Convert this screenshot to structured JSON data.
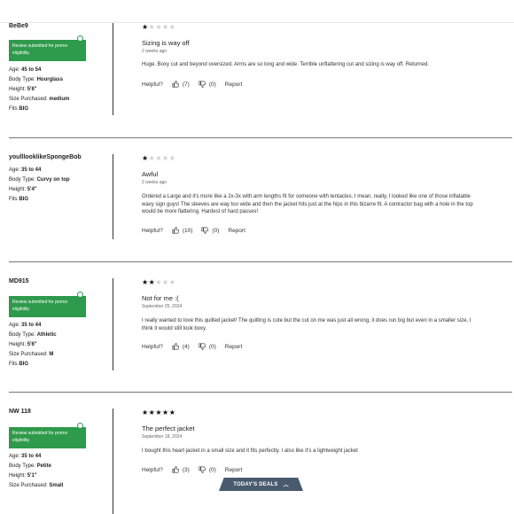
{
  "reviews": [
    {
      "user": "BeBe9",
      "badge": "Review submitted for promo eligibility.",
      "attributes": [
        {
          "label": "Age:",
          "value": "45 to 54"
        },
        {
          "label": "Body Type:",
          "value": "Hourglass"
        },
        {
          "label": "Height:",
          "value": "5'6\""
        },
        {
          "label": "Size Purchased:",
          "value": "medium"
        },
        {
          "label": "Fits",
          "value": "BIG"
        }
      ],
      "rating": 1,
      "title": "Sizing is way off",
      "date": "2 weeks ago",
      "body": "Huge. Boxy cut and beyond oversized. Arms are so long and wide. Terrible unflattering cut and sizing is way off. Returned.",
      "helpful_label": "Helpful?",
      "up": "(7)",
      "down": "(0)",
      "report": "Report"
    },
    {
      "user": "youlllooklikeSpongeBob",
      "attributes": [
        {
          "label": "Age:",
          "value": "35 to 44"
        },
        {
          "label": "Body Type:",
          "value": "Curvy on top"
        },
        {
          "label": "Height:",
          "value": "5'4\""
        },
        {
          "label": "Fits",
          "value": "BIG"
        }
      ],
      "rating": 1,
      "title": "Awful",
      "date": "2 weeks ago",
      "body": "Ordered a Large and it's more like a 2x-3x with arm lengths fit for someone with tentacles. I mean, really, I looked like one of those inflatable wavy sign guys! The sleeves are way too wide and then the jacket hits just at the hips in this bizarre fit. A contractor bag with a hole in the top would be more flattering. Hardest of hard passes!",
      "helpful_label": "Helpful?",
      "up": "(10)",
      "down": "(0)",
      "report": "Report"
    },
    {
      "user": "MD915",
      "badge": "Review submitted for promo eligibility.",
      "attributes": [
        {
          "label": "Age:",
          "value": "35 to 44"
        },
        {
          "label": "Body Type:",
          "value": "Athletic"
        },
        {
          "label": "Height:",
          "value": "5'6\""
        },
        {
          "label": "Size Purchased:",
          "value": "M"
        },
        {
          "label": "Fits",
          "value": "BIG"
        }
      ],
      "rating": 2,
      "title": "Not for me :(",
      "date": "September 25, 2024",
      "body": "I really wanted to love this quilted jacket! The quilting is cute but the cut on me was just all wrong, it does run big but even in a smaller size, I think it would still look boxy.",
      "helpful_label": "Helpful?",
      "up": "(4)",
      "down": "(0)",
      "report": "Report"
    },
    {
      "user": "NW 118",
      "badge": "Review submitted for promo eligibility.",
      "attributes": [
        {
          "label": "Age:",
          "value": "35 to 44"
        },
        {
          "label": "Body Type:",
          "value": "Petite"
        },
        {
          "label": "Height:",
          "value": "5'1\""
        },
        {
          "label": "Size Purchased:",
          "value": "Small"
        }
      ],
      "rating": 5,
      "title": "The perfect jacket",
      "date": "September 18, 2024",
      "body": "I bought this heart jacket in a small size and it fits perfectly. I also like it's a lightweight jacket",
      "helpful_label": "Helpful?",
      "up": "(3)",
      "down": "(0)",
      "report": "Report"
    }
  ],
  "todays_deals": "TODAY'S DEALS",
  "icons": {
    "thumbs_up": "thumbs-up-icon",
    "thumbs_down": "thumbs-down-icon",
    "chevron": "chevron-up-icon"
  }
}
